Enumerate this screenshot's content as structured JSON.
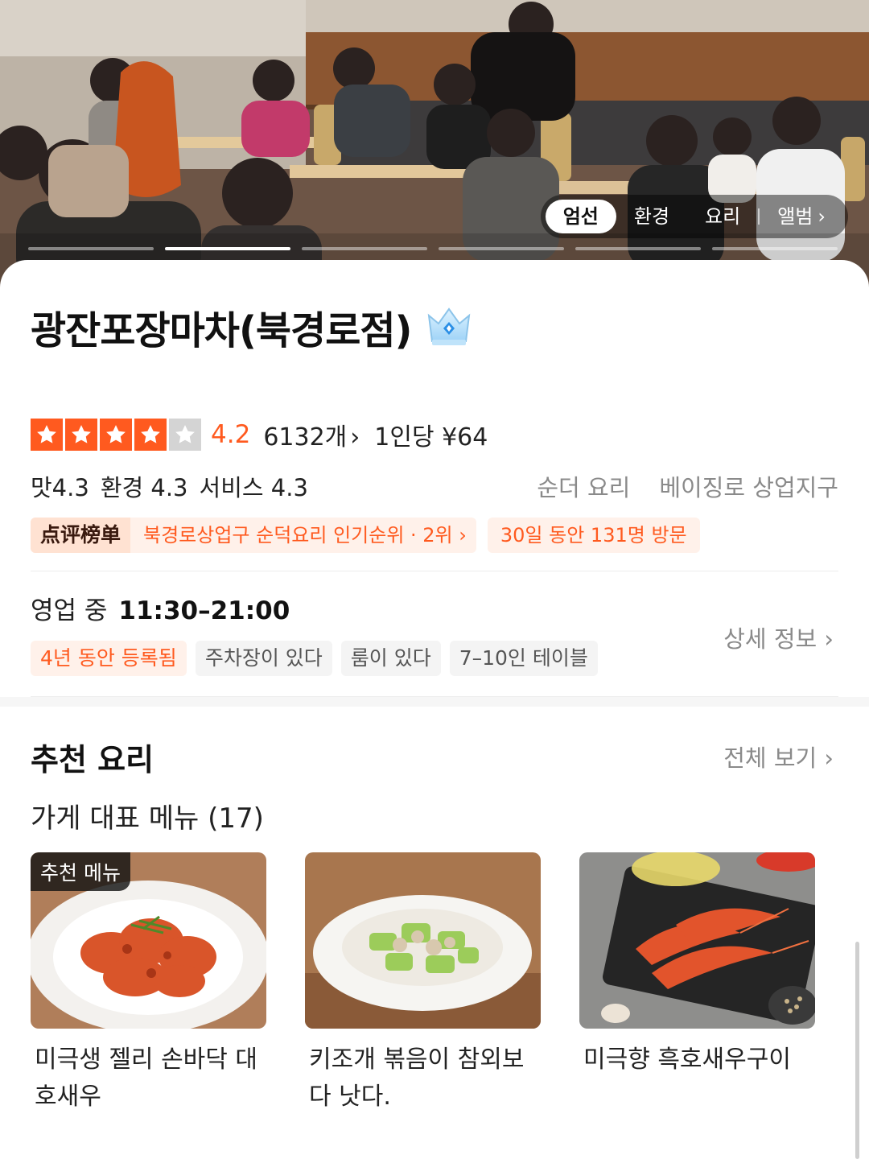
{
  "gallery": {
    "tabs": [
      {
        "label": "엄선",
        "active": true
      },
      {
        "label": "환경",
        "active": false
      },
      {
        "label": "요리",
        "active": false
      },
      {
        "label": "앨범",
        "active": false
      }
    ],
    "album_chevron": "›",
    "progress_segments": 6,
    "progress_active_index": 1
  },
  "restaurant": {
    "name": "광잔포장마차(북경로점)",
    "badge_icon": "crown-icon",
    "rating": {
      "stars_filled": 4,
      "stars_total": 5,
      "score": "4.2",
      "review_count": "6132개",
      "review_chevron": "›",
      "per_person": "1인당 ¥64"
    },
    "sub_scores": [
      "맛4.3",
      "환경 4.3",
      "서비스 4.3"
    ],
    "category": "순더 요리",
    "district": "베이징로 상업지구",
    "ranking": {
      "logo_text": "点评榜单",
      "text": "북경로상업구 순덕요리 인기순위 · 2위",
      "chevron": "›"
    },
    "visits": "30일 동안 131명 방문",
    "hours": {
      "status": "영업 중",
      "time": "11:30–21:00"
    },
    "detail_link": "상세 정보 ›",
    "features": [
      {
        "label": "4년 동안 등록됨",
        "accent": true
      },
      {
        "label": "주차장이 있다",
        "accent": false
      },
      {
        "label": "룸이 있다",
        "accent": false
      },
      {
        "label": "7–10인 테이블",
        "accent": false
      }
    ]
  },
  "recommended": {
    "title": "추천 요리",
    "see_all": "전체 보기 ›",
    "menu_header": "가게 대표 메뉴 (17)",
    "dishes": [
      {
        "name": "미극생 젤리 손바닥 대호새우",
        "tag": "추천 메뉴"
      },
      {
        "name": "키조개 볶음이 참외보다 낫다.",
        "tag": ""
      },
      {
        "name": "미극향 흑호새우구이",
        "tag": ""
      }
    ]
  },
  "colors": {
    "accent": "#ff5a1f",
    "accent_bg": "#fff1ea",
    "muted_text": "#8a8a8a",
    "chip_bg": "#f4f4f4"
  }
}
